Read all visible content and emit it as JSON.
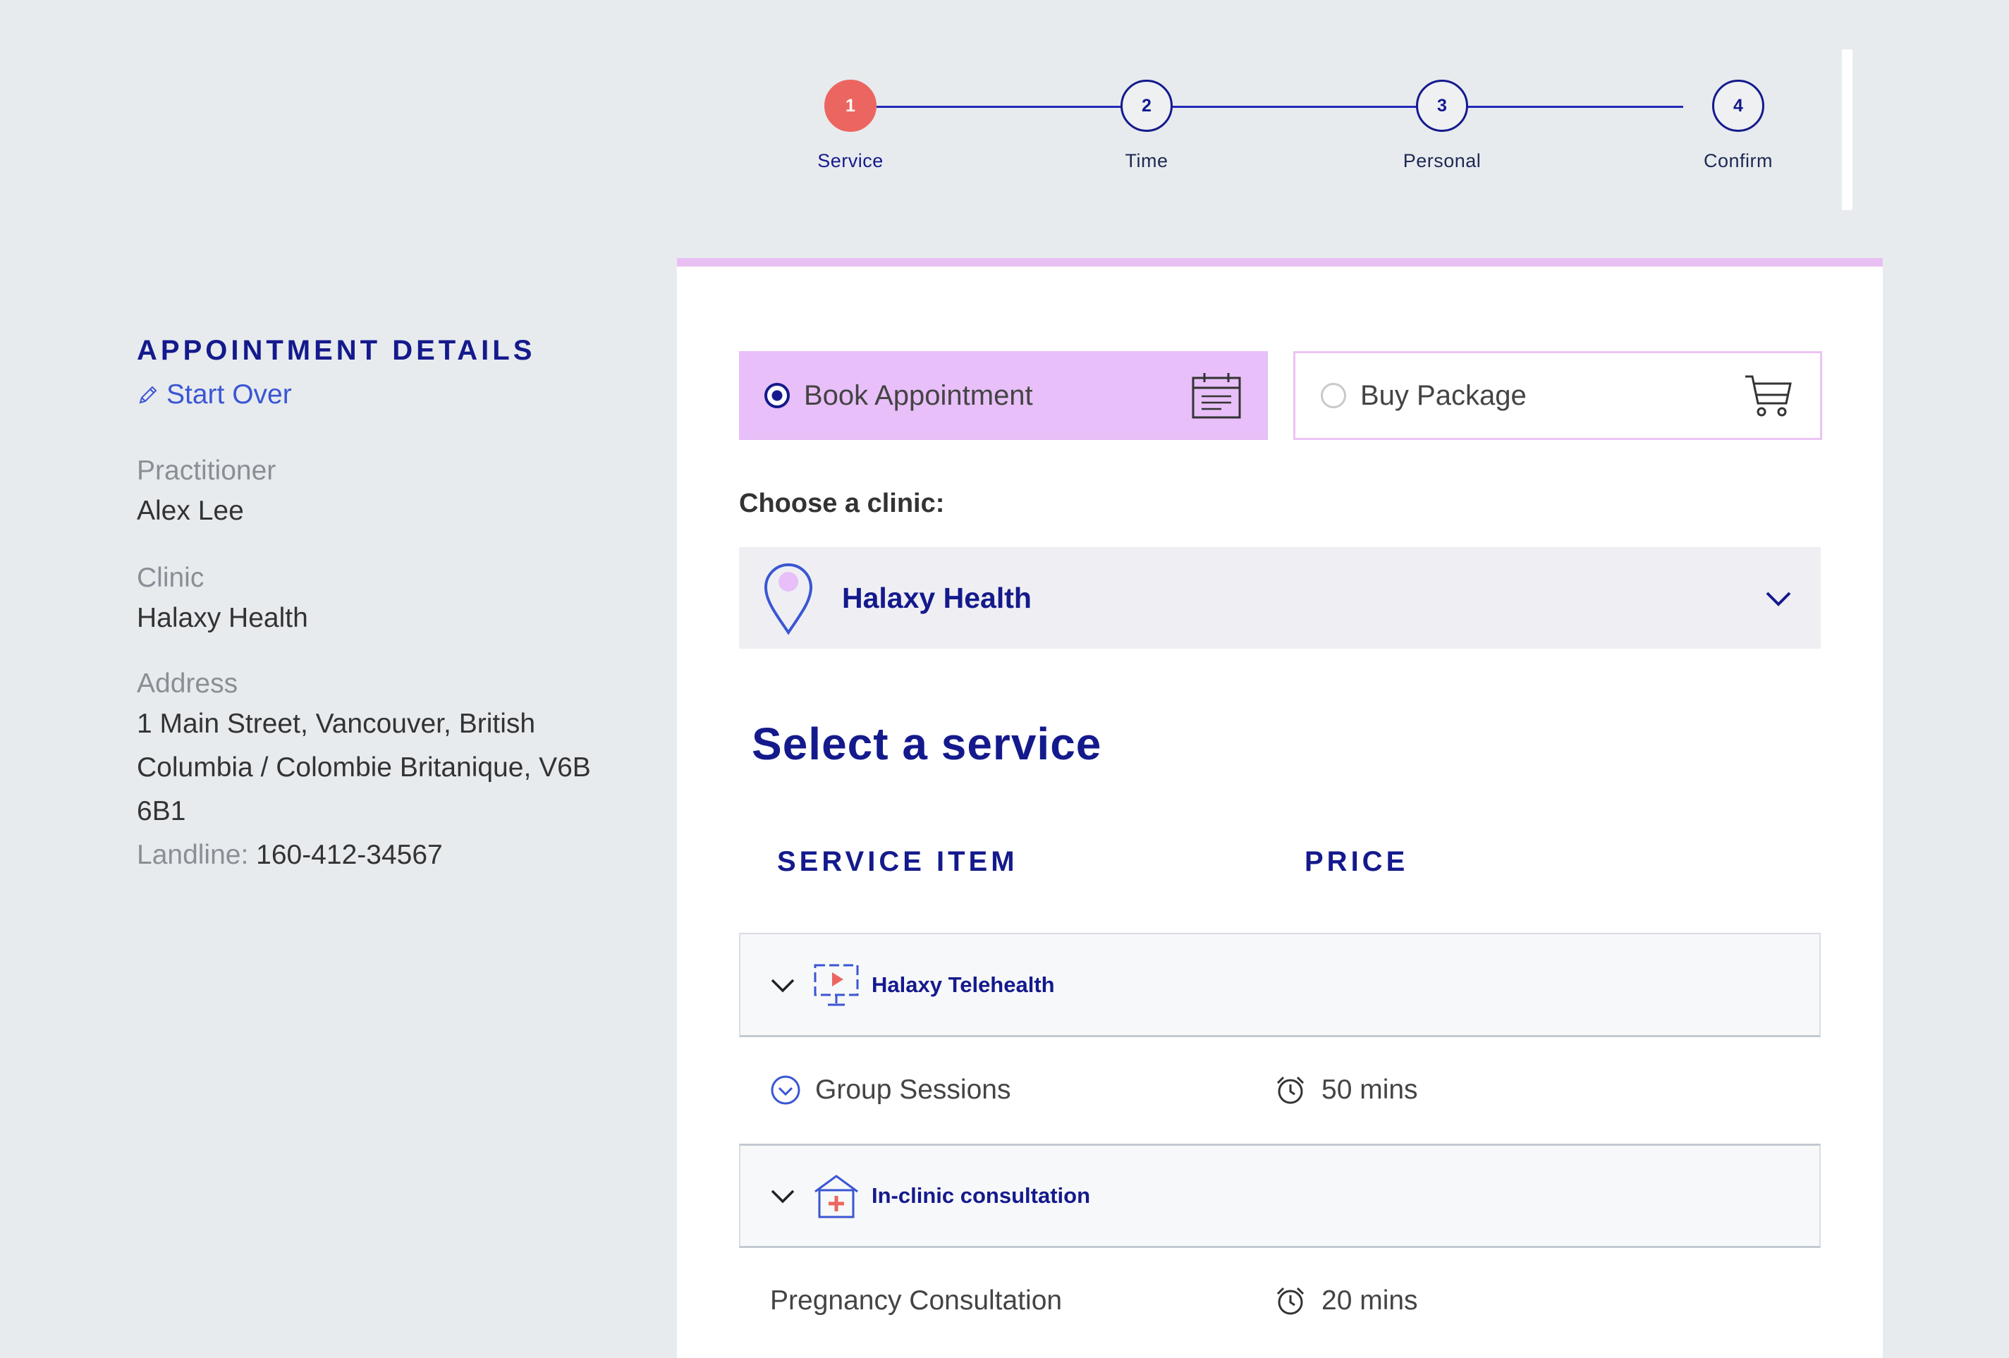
{
  "stepper": {
    "steps": [
      {
        "number": "1",
        "label": "Service",
        "active": true
      },
      {
        "number": "2",
        "label": "Time",
        "active": false
      },
      {
        "number": "3",
        "label": "Personal",
        "active": false
      },
      {
        "number": "4",
        "label": "Confirm",
        "active": false
      }
    ]
  },
  "sidebar": {
    "title": "APPOINTMENT DETAILS",
    "start_over": "Start Over",
    "practitioner_label": "Practitioner",
    "practitioner_value": "Alex Lee",
    "clinic_label": "Clinic",
    "clinic_value": "Halaxy Health",
    "address_label": "Address",
    "address_value": "1 Main Street, Vancouver, British Columbia / Colombie Britanique, V6B 6B1",
    "landline_label": "Landline:",
    "landline_value": "160-412-34567"
  },
  "booking_type": {
    "book_label": "Book Appointment",
    "package_label": "Buy Package",
    "selected": "Book Appointment"
  },
  "clinic_select": {
    "label": "Choose a clinic:",
    "value": "Halaxy Health"
  },
  "services": {
    "title": "Select a service",
    "col_item": "SERVICE ITEM",
    "col_price": "PRICE",
    "groups": [
      {
        "name": "Halaxy Telehealth",
        "icon": "telehealth-monitor-icon",
        "items": [
          {
            "name": "Group Sessions",
            "duration": "50 mins"
          }
        ]
      },
      {
        "name": "In-clinic consultation",
        "icon": "clinic-house-icon",
        "items": [
          {
            "name": "Pregnancy Consultation",
            "duration": "20 mins"
          }
        ]
      }
    ]
  },
  "colors": {
    "primary": "#141a8c",
    "accent_pink": "#e8bff8",
    "active_step": "#ec6661",
    "link_blue": "#3a56d4"
  }
}
